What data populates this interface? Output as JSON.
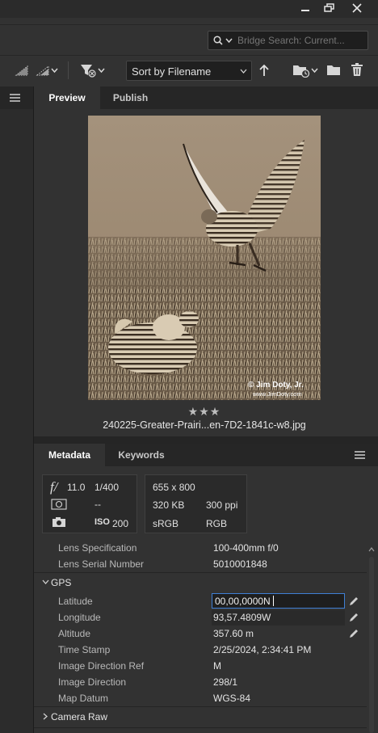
{
  "window": {
    "minimize_label": "—",
    "restore_label": "❐",
    "close_label": "✕"
  },
  "search": {
    "placeholder": "Bridge Search: Current..."
  },
  "toolbar": {
    "sort_label": "Sort by Filename"
  },
  "preview_tabs": [
    {
      "label": "Preview",
      "active": true
    },
    {
      "label": "Publish",
      "active": false
    }
  ],
  "preview": {
    "stars": "★★★",
    "rating": 3,
    "filename": "240225-Greater-Prairi...en-7D2-1841c-w8.jpg",
    "watermark": "© Jim Doty, Jr.\nwww.JimDoty.com"
  },
  "metadata_tabs": [
    {
      "label": "Metadata",
      "active": true
    },
    {
      "label": "Keywords",
      "active": false
    }
  ],
  "camera_summary": {
    "aperture_symbol": "f/",
    "aperture": "11.0",
    "shutter": "1/400",
    "metering": "--",
    "iso_label": "ISO",
    "iso": "200"
  },
  "file_summary": {
    "dimensions": "655 x 800",
    "size": "320 KB",
    "resolution": "300 ppi",
    "profile": "sRGB",
    "mode": "RGB"
  },
  "top_rows": [
    {
      "label": "Lens Specification",
      "value": "100-400mm f/0"
    },
    {
      "label": "Lens Serial Number",
      "value": "5010001848"
    }
  ],
  "gps": {
    "section_label": "GPS",
    "rows": [
      {
        "label": "Latitude",
        "value": "00,00,0000N",
        "editable": true,
        "editing": true
      },
      {
        "label": "Longitude",
        "value": "93,57.4809W",
        "editable": true,
        "editing": false
      },
      {
        "label": "Altitude",
        "value": "357.60 m",
        "editable": true,
        "editing": false
      },
      {
        "label": "Time Stamp",
        "value": "2/25/2024, 2:34:41 PM",
        "editable": false
      },
      {
        "label": "Image Direction Ref",
        "value": "M",
        "editable": false
      },
      {
        "label": "Image Direction",
        "value": "298/1",
        "editable": false
      },
      {
        "label": "Map Datum",
        "value": "WGS-84",
        "editable": false
      }
    ]
  },
  "camera_raw": {
    "section_label": "Camera Raw"
  }
}
